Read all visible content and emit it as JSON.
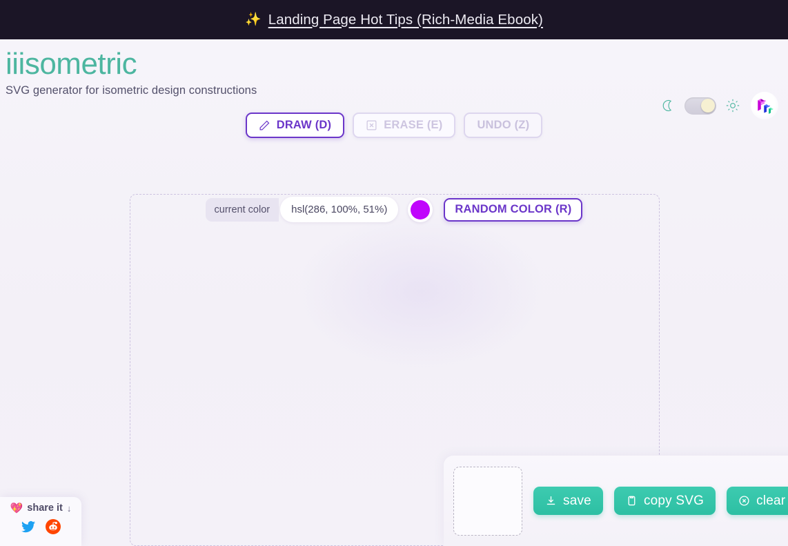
{
  "banner": {
    "sparkle_icon": "sparkles-icon",
    "link_text": "Landing Page Hot Tips (Rich-Media Ebook)"
  },
  "header": {
    "title": "iiisometric",
    "subtitle": "SVG generator for isometric design constructions",
    "brand_color": "#4db6a0",
    "moon_icon": "moon-icon",
    "sun_icon": "sun-icon",
    "theme_toggle_state": "light",
    "logo_icon": "fff-isometric-logo-icon"
  },
  "tools": [
    {
      "label": "DRAW (D)",
      "icon": "pencil-icon",
      "state": "active",
      "key": "D"
    },
    {
      "label": "ERASE (E)",
      "icon": "erase-square-icon",
      "state": "disabled",
      "key": "E"
    },
    {
      "label": "UNDO (Z)",
      "icon": "none",
      "state": "disabled",
      "key": "Z"
    }
  ],
  "color": {
    "label": "current color",
    "value": "hsl(286, 100%, 51%)",
    "swatch_hex": "#c006fc",
    "random_button": "RANDOM COLOR (R)",
    "accent_hex": "#6b36c9"
  },
  "canvas": {
    "border_style": "dashed",
    "border_color": "#cdc3e0",
    "content": ""
  },
  "export": {
    "preview_label": "",
    "buttons": [
      {
        "label": "save",
        "icon": "download-icon"
      },
      {
        "label": "copy SVG",
        "icon": "clipboard-icon"
      },
      {
        "label": "clear",
        "icon": "circle-x-icon"
      }
    ],
    "button_hex": "#2dbfa3"
  },
  "share": {
    "heart_icon": "heart-icon",
    "label": "share it",
    "arrow": "↓",
    "icons": [
      {
        "name": "twitter-icon",
        "hex": "#1da1f2"
      },
      {
        "name": "reddit-icon",
        "hex": "#ff4500"
      }
    ]
  }
}
